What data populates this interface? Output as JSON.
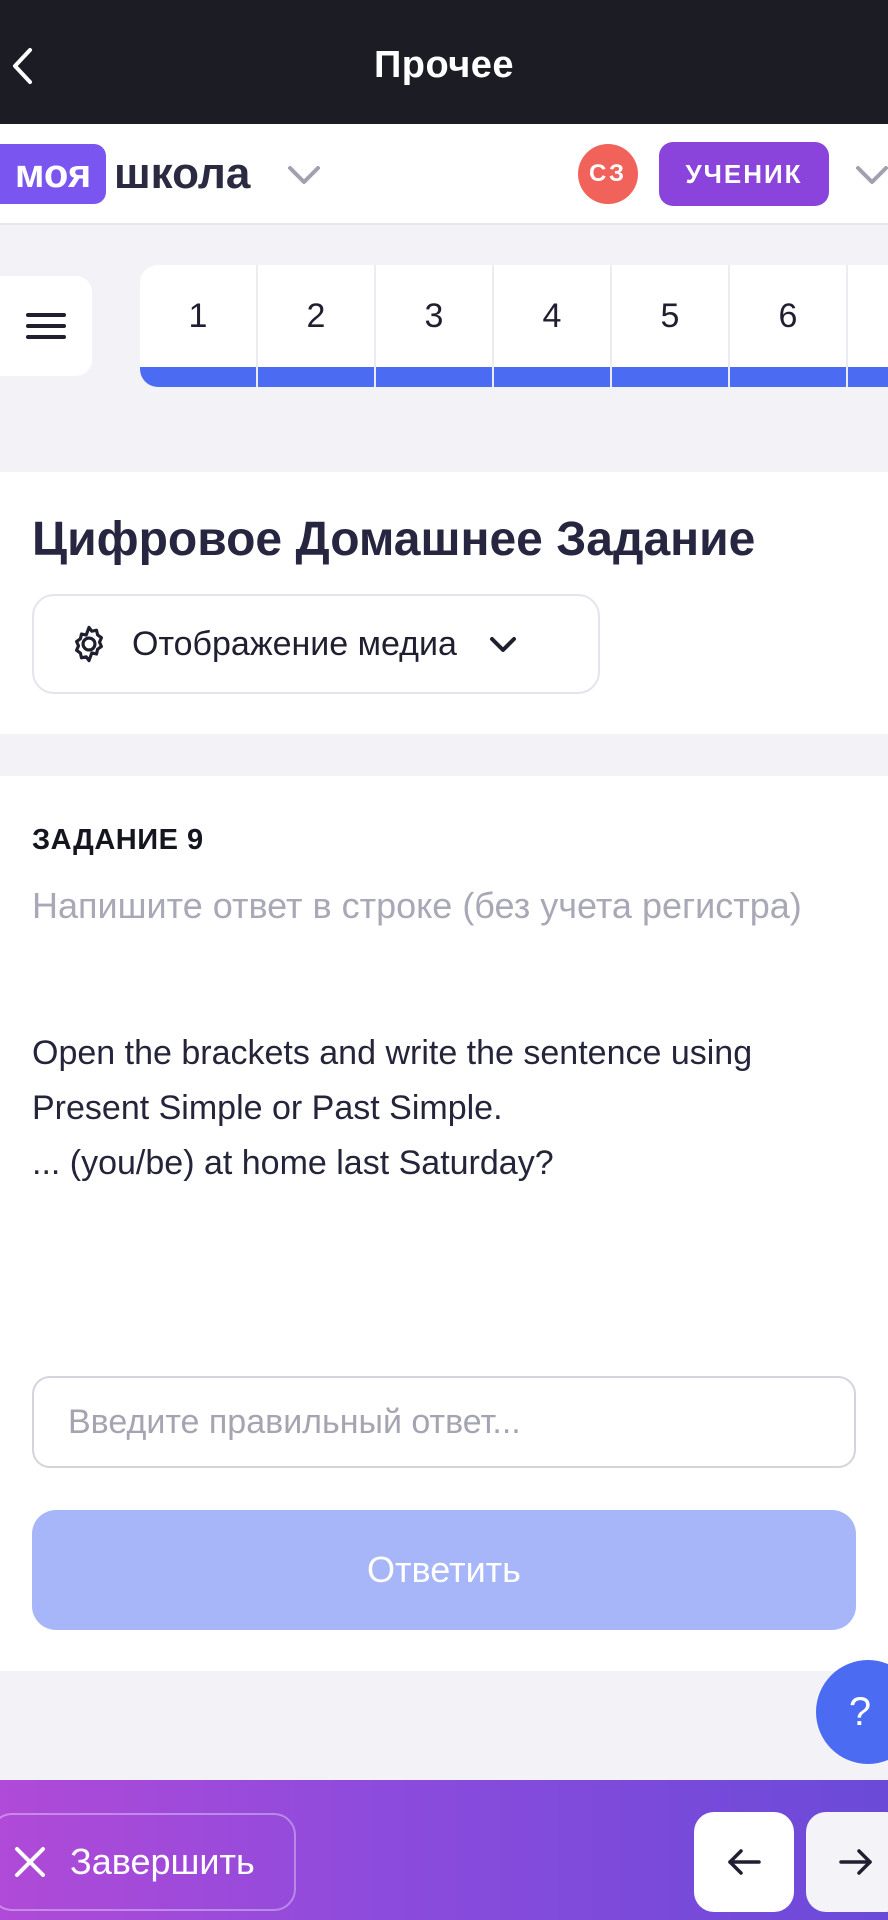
{
  "topbar": {
    "title": "Прочее"
  },
  "header": {
    "logo_part1": "моя",
    "logo_part2": "школа",
    "avatar_initials": "СЗ",
    "role": "УЧЕНИК"
  },
  "tasks": {
    "numbers": [
      "1",
      "2",
      "3",
      "4",
      "5",
      "6"
    ]
  },
  "homework": {
    "title": "Цифровое Домашнее Задание",
    "media_toggle_label": "Отображение медиа"
  },
  "task": {
    "heading": "ЗАДАНИЕ 9",
    "hint": "Напишите ответ в строке (без учета регистра)",
    "text": "Open the brackets and write the sentence using Present Simple or Past Simple.\n ... (you/be) at home last Saturday?",
    "input_placeholder": "Введите правильный ответ...",
    "input_value": "",
    "submit_label": "Ответить"
  },
  "help": {
    "label": "?"
  },
  "bottom": {
    "finish_label": "Завершить"
  },
  "colors": {
    "accent_blue": "#4a6bf2",
    "brand_purple": "#7b55f0",
    "role_purple": "#8a44dc",
    "avatar_red": "#f0625a",
    "submit_disabled": "#a6b6f8"
  },
  "icons": {
    "back": "chevron-left-icon",
    "menu": "hamburger-icon",
    "gear": "gear-icon",
    "chevron": "chevron-down-icon",
    "close": "close-icon",
    "prev": "arrow-left-icon",
    "next": "arrow-right-icon"
  }
}
